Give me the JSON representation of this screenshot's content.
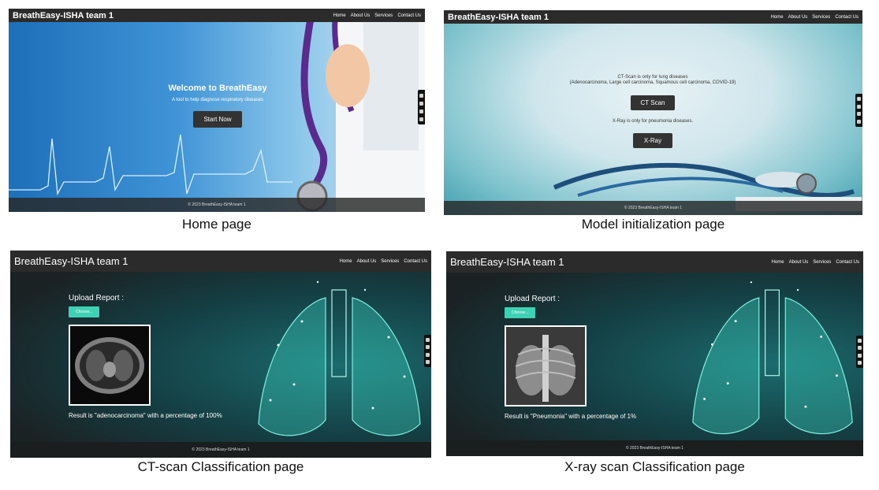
{
  "nav_links": [
    "Home",
    "About Us",
    "Services",
    "Contact Us"
  ],
  "brand": "BreathEasy-ISHA team 1",
  "footer": "© 2023 BreathEasy-ISHA team 1",
  "home": {
    "title": "Welcome to BreathEasy",
    "subtitle": "A tool to help diagnose respiratory diseases",
    "button": "Start Now",
    "caption": "Home page"
  },
  "model": {
    "ct_note_1": "CT-Scan is only for lung diseases",
    "ct_note_2": "(Adenocarcinoma, Large cell carcinoma, Squamous cell carcinoma, COVID-19)",
    "ct_button": "CT Scan",
    "xray_note": "X-Ray is only for pneumonia diseases.",
    "xray_button": "X-Ray",
    "caption": "Model initialization page"
  },
  "ct": {
    "upload_label": "Upload Report :",
    "choose_button": "Choose...",
    "result": "Result is \"adenocarcinoma\" with a percentage of 100%",
    "caption": "CT-scan Classification page"
  },
  "xray": {
    "upload_label": "Upload Report :",
    "choose_button": "Choose...",
    "result": "Result is \"Pneumonia\" with a percentage of 1%",
    "caption": "X-ray scan Classification page"
  },
  "colors": {
    "navbar": "#2b2b2b",
    "accent_teal": "#3fd1b4",
    "button_dark": "#333333"
  }
}
